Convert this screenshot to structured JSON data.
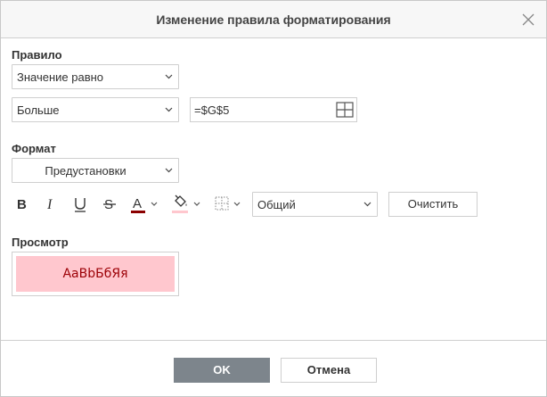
{
  "dialog": {
    "title": "Изменение правила форматирования",
    "close_icon": "close-icon"
  },
  "rule": {
    "label": "Правило",
    "rule_type_value": "Значение равно",
    "condition_value": "Больше",
    "formula_value": "=$G$5",
    "range_icon": "select-range-icon"
  },
  "format": {
    "label": "Формат",
    "preset_value": "Предустановки",
    "bold_icon": "bold-icon",
    "italic_icon": "italic-icon",
    "underline_icon": "underline-icon",
    "strikethrough_icon": "strikethrough-icon",
    "font_color_icon": "font-color-icon",
    "fill_color_icon": "fill-color-icon",
    "borders_icon": "borders-icon",
    "number_format_value": "Общий",
    "clear_label": "Очистить",
    "font_color": "#8b0000",
    "fill_color": "#ffc7ce"
  },
  "preview": {
    "label": "Просмотр",
    "sample_text": "AaBbБбЯя",
    "text_color": "#9c0006",
    "background": "#ffc7ce"
  },
  "footer": {
    "ok_label": "OK",
    "cancel_label": "Отмена",
    "ok_color": "#7d858c"
  }
}
